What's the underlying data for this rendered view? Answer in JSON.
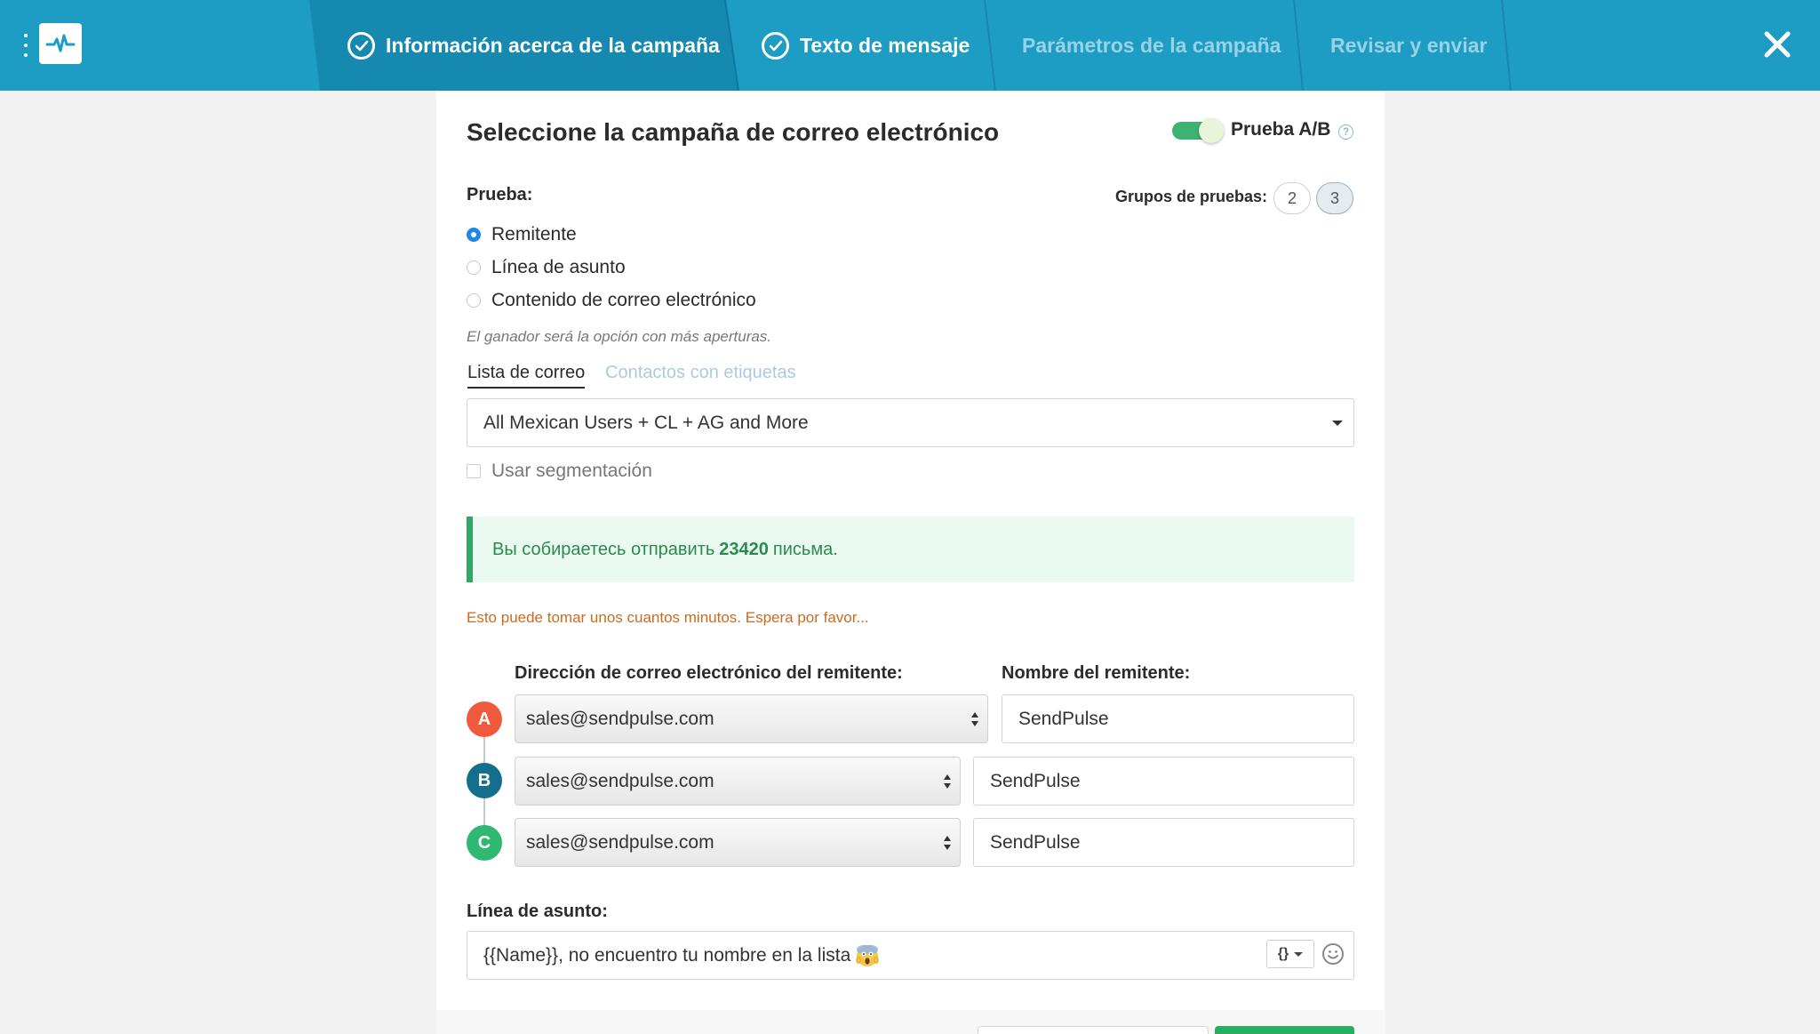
{
  "header": {
    "steps": [
      {
        "label": "Información acerca de la campaña",
        "state": "done"
      },
      {
        "label": "Texto de mensaje",
        "state": "done"
      },
      {
        "label": "Parámetros de la campaña",
        "state": "pending"
      },
      {
        "label": "Revisar y enviar",
        "state": "pending"
      }
    ],
    "colors": {
      "bar": "#1d9cc4",
      "active_step": "#1589b0"
    },
    "icons": {
      "menu": "kebab-menu-icon",
      "logo": "pulse-logo-icon",
      "close": "close-icon"
    }
  },
  "page": {
    "title": "Seleccione la campaña de correo electrónico",
    "ab_test": {
      "label": "Prueba A/B",
      "enabled": true
    }
  },
  "test": {
    "label": "Prueba:",
    "groups_label": "Grupos de pruebas:",
    "groups": [
      "2",
      "3"
    ],
    "selected_group": "3",
    "options": [
      {
        "label": "Remitente",
        "checked": true
      },
      {
        "label": "Línea de asunto",
        "checked": false
      },
      {
        "label": "Contenido de correo electrónico",
        "checked": false
      }
    ],
    "hint": "El ganador será la opción con más aperturas."
  },
  "recipients": {
    "tabs": [
      {
        "label": "Lista de correo",
        "active": true
      },
      {
        "label": "Contactos con etiquetas",
        "active": false
      }
    ],
    "list_value": "All Mexican Users + CL + AG and More",
    "segmentation_label": "Usar segmentación",
    "segmentation_checked": false
  },
  "alert": {
    "prefix": "Вы собираетесь отправить",
    "count": "23420",
    "suffix": "письма.",
    "color": "#2fa866"
  },
  "warning": "Esto puede tomar unos cuantos minutos. Espera por favor...",
  "senders": {
    "email_label": "Dirección de correo electrónico del remitente:",
    "name_label": "Nombre del remitente:",
    "rows": [
      {
        "badge": "A",
        "color": "#ef5a3c",
        "email": "sales@sendpulse.com",
        "name": "SendPulse"
      },
      {
        "badge": "B",
        "color": "#136f8c",
        "email": "sales@sendpulse.com",
        "name": "SendPulse"
      },
      {
        "badge": "C",
        "color": "#2eb872",
        "email": "sales@sendpulse.com",
        "name": "SendPulse"
      }
    ]
  },
  "subject": {
    "label": "Línea de asunto:",
    "value": "{{Name}}, no encuentro tu nombre en la lista",
    "emoji": "screaming-face-emoji",
    "merge_button": "{}",
    "icons": {
      "emoji_picker": "smiley-icon"
    }
  }
}
